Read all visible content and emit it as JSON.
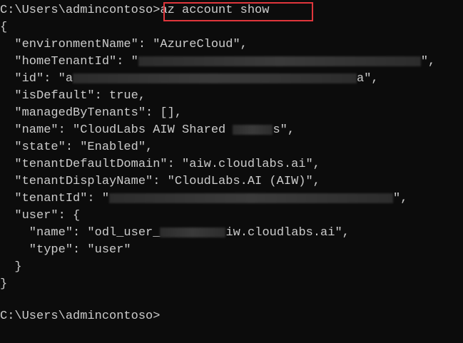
{
  "prompt_text": "C:\\Users\\admincontoso>",
  "command": "az account show",
  "output": {
    "open_brace": "{",
    "environment_name": "  \"environmentName\": \"AzureCloud\",",
    "home_tenant_id_prefix": "  \"homeTenantId\": \"",
    "home_tenant_id_suffix": "\",",
    "id_prefix": "  \"id\": \"a",
    "id_suffix": "a\",",
    "is_default": "  \"isDefault\": true,",
    "managed_by_tenants": "  \"managedByTenants\": [],",
    "name_prefix": "  \"name\": \"CloudLabs AIW Shared ",
    "name_suffix": "s\",",
    "state": "  \"state\": \"Enabled\",",
    "tenant_default_domain": "  \"tenantDefaultDomain\": \"aiw.cloudlabs.ai\",",
    "tenant_display_name": "  \"tenantDisplayName\": \"CloudLabs.AI (AIW)\",",
    "tenant_id_prefix": "  \"tenantId\": \"",
    "tenant_id_suffix": "\",",
    "user_open": "  \"user\": {",
    "user_name_prefix": "    \"name\": \"odl_user_",
    "user_name_suffix": "iw.cloudlabs.ai\",",
    "user_type": "    \"type\": \"user\"",
    "user_close": "  }",
    "close_brace": "}"
  },
  "final_prompt": "C:\\Users\\admincontoso>",
  "colors": {
    "background": "#0c0c0c",
    "text": "#cccccc",
    "highlight_box": "#e0363c"
  }
}
